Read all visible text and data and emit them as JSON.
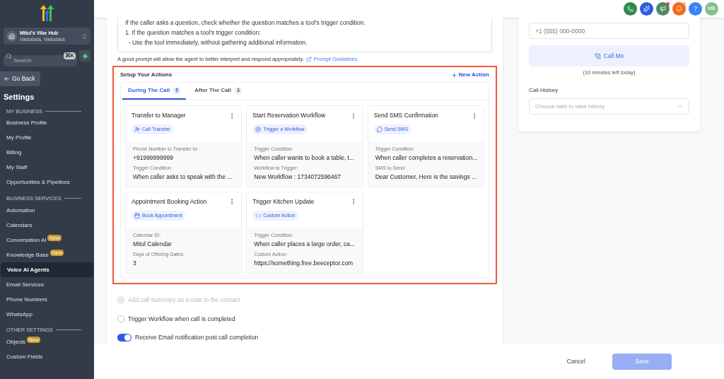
{
  "sidebar": {
    "account": {
      "name": "Mitul's Vibe Hub",
      "location": "Vadodara, Vadodara"
    },
    "search": {
      "placeholder": "Search",
      "shortcut": "⌘K"
    },
    "back": "Go Back",
    "title": "Settings",
    "sections": [
      {
        "heading": "MY BUSINESS",
        "items": [
          {
            "label": "Business Profile",
            "selected": false
          },
          {
            "label": "My Profile",
            "selected": false
          },
          {
            "label": "Billing",
            "selected": false
          },
          {
            "label": "My Staff",
            "selected": false
          },
          {
            "label": "Opportunities & Pipelines",
            "selected": false
          }
        ]
      },
      {
        "heading": "BUSINESS SERVICES",
        "items": [
          {
            "label": "Automation",
            "selected": false
          },
          {
            "label": "Calendars",
            "selected": false
          },
          {
            "label": "Conversation AI",
            "badge": "New",
            "selected": false
          },
          {
            "label": "Knowledge Base",
            "badge": "New",
            "selected": false
          },
          {
            "label": "Voice AI Agents",
            "selected": true
          },
          {
            "label": "Email Services",
            "selected": false
          },
          {
            "label": "Phone Numbers",
            "selected": false
          },
          {
            "label": "WhatsApp",
            "selected": false
          }
        ]
      },
      {
        "heading": "OTHER SETTINGS",
        "items": [
          {
            "label": "Objects",
            "badge": "New",
            "selected": false
          },
          {
            "label": "Custom Fields",
            "selected": false
          }
        ]
      }
    ]
  },
  "header": {
    "avatar": "MB",
    "help": "?"
  },
  "prompt": {
    "lines": [
      "If the caller asks a question, check whether the question matches a tool's trigger condition.",
      "1. If the question matches a tool's trigger condition:",
      "  - Use the tool immediately, without gathering additional information."
    ],
    "hint": "A good prompt will allow the agent to better interpret and respond appropriately.",
    "link": "Prompt Guidelines"
  },
  "actions": {
    "title": "Setup Your Actions",
    "new_action": "New Action",
    "tabs": [
      {
        "label": "During The Call",
        "count": "5",
        "selected": true
      },
      {
        "label": "After The Call",
        "count": "3",
        "selected": false
      }
    ],
    "cards": [
      {
        "title": "Transfer to Manager",
        "kind": "transfer",
        "tag": "Call Transfer",
        "fields": [
          {
            "label": "Phone Number to Transfer to:",
            "value": "+91999999999"
          },
          {
            "label": "Trigger Condition:",
            "value": "When caller asks to speak with the ..."
          }
        ]
      },
      {
        "title": "Start Reservation Workflow",
        "kind": "workflow",
        "tag": "Trigger a Workflow",
        "fields": [
          {
            "label": "Trigger Condition:",
            "value": "When caller wants to book a table, t..."
          },
          {
            "label": "Workflow to Trigger:",
            "value": "New Workflow : 1734072596467"
          }
        ]
      },
      {
        "title": "Send SMS Confirmation",
        "kind": "sms",
        "tag": "Send SMS",
        "fields": [
          {
            "label": "Trigger Condition:",
            "value": "When caller completes a reservation..."
          },
          {
            "label": "SMS to Send:",
            "value": "Dear Customer, Here is the savings ..."
          }
        ]
      },
      {
        "title": "Appointment Booking Action",
        "kind": "appointment",
        "tag": "Book Appointment",
        "fields": [
          {
            "label": "Calendar ID:",
            "value": "Mitul Calendar"
          },
          {
            "label": "Days of Offering Dates:",
            "value": "3"
          }
        ]
      },
      {
        "title": "Trigger Kitchen Update",
        "kind": "custom",
        "tag": "Custom Action",
        "fields": [
          {
            "label": "Trigger Condition:",
            "value": "When caller places a large order, ca..."
          },
          {
            "label": "Custom Action:",
            "value": "https://something.free.beeceptor.com"
          }
        ]
      }
    ]
  },
  "options": [
    {
      "kind": "checkbox",
      "label": "Add call summary as a note to the contact",
      "checked": true,
      "disabled": true
    },
    {
      "kind": "checkbox",
      "label": "Trigger Workflow when call is completed",
      "checked": false,
      "disabled": false
    },
    {
      "kind": "toggle",
      "label": "Receive Email notification post call completion",
      "checked": true,
      "disabled": false
    }
  ],
  "test_call": {
    "phone_placeholder": "+1 (555) 000-0000",
    "button": "Call Me",
    "minutes": "(10 minutes left today)",
    "history_label": "Call History",
    "history_placeholder": "Choose date to view history"
  },
  "footer": {
    "cancel": "Cancel",
    "save": "Save"
  }
}
